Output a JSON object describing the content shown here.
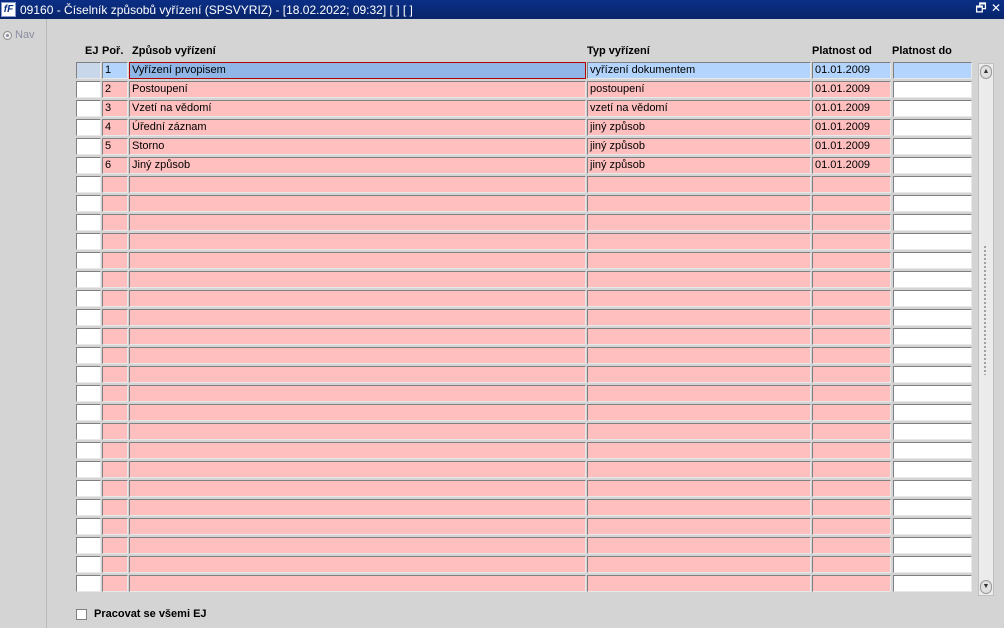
{
  "window": {
    "icon_text": "fF",
    "title": "09160 - Číselník způsobů vyřízení (SPSVYRIZ) - [18.02.2022; 09:32]  [ ]  [ ]",
    "restore_glyph": "🗗",
    "close_glyph": "✕"
  },
  "nav": {
    "label": "Nav"
  },
  "table": {
    "headers": {
      "ej": "EJ",
      "por": "Poř.",
      "zpusob": "Způsob vyřízení",
      "typ": "Typ vyřízení",
      "od": "Platnost od",
      "do": "Platnost do"
    },
    "rows": [
      {
        "ej": "",
        "por": "1",
        "zpusob": "Vyřízení prvopisem",
        "typ": "vyřízení dokumentem",
        "od": "01.01.2009",
        "do": ""
      },
      {
        "ej": "",
        "por": "2",
        "zpusob": "Postoupení",
        "typ": "postoupení",
        "od": "01.01.2009",
        "do": ""
      },
      {
        "ej": "",
        "por": "3",
        "zpusob": "Vzetí na vědomí",
        "typ": "vzetí na vědomí",
        "od": "01.01.2009",
        "do": ""
      },
      {
        "ej": "",
        "por": "4",
        "zpusob": "Úřední záznam",
        "typ": "jiný způsob",
        "od": "01.01.2009",
        "do": ""
      },
      {
        "ej": "",
        "por": "5",
        "zpusob": "Storno",
        "typ": "jiný způsob",
        "od": "01.01.2009",
        "do": ""
      },
      {
        "ej": "",
        "por": "6",
        "zpusob": "Jiný způsob",
        "typ": "jiný způsob",
        "od": "01.01.2009",
        "do": ""
      }
    ],
    "total_rows": 28
  },
  "scroll": {
    "up": "▲",
    "down": "▼"
  },
  "footer": {
    "checkbox_label": "Pracovat se všemi EJ"
  }
}
